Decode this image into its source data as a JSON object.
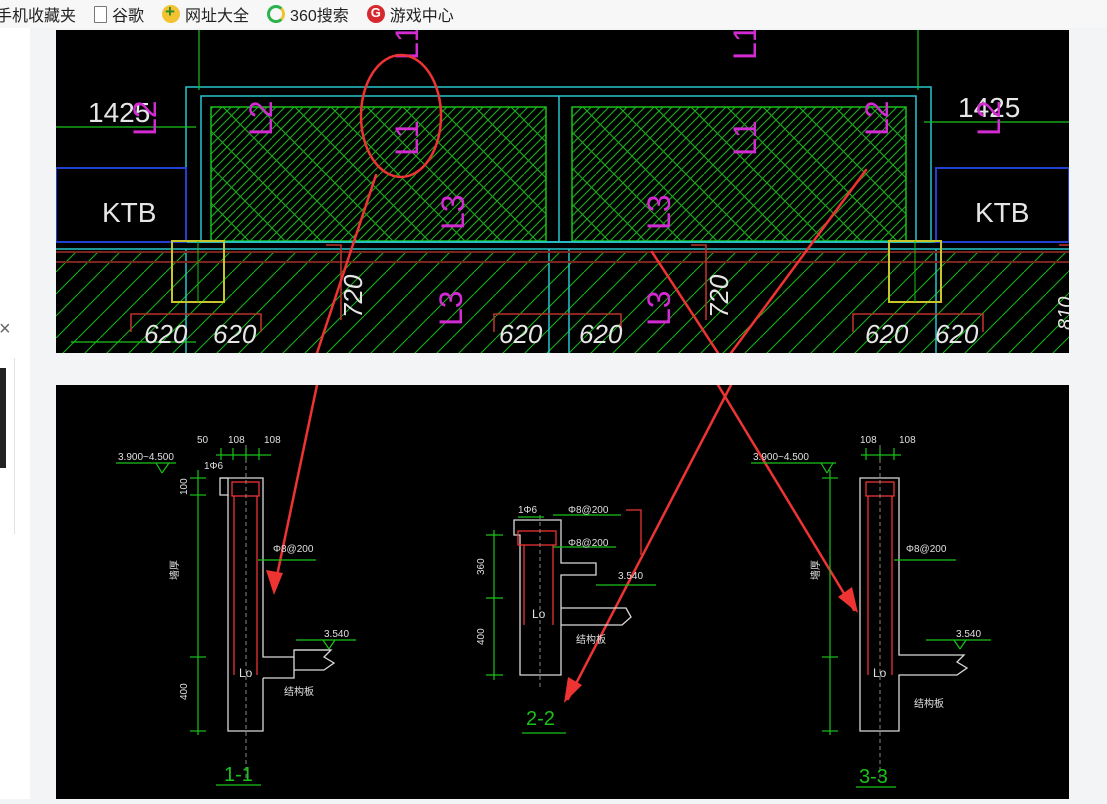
{
  "bookmarks": [
    {
      "label": "手机收藏夹",
      "icon": "bookmark-folder-icon"
    },
    {
      "label": "谷歌",
      "icon": "page-icon"
    },
    {
      "label": "网址大全",
      "icon": "web-nav-icon"
    },
    {
      "label": "360搜索",
      "icon": "360-search-icon"
    },
    {
      "label": "游戏中心",
      "icon": "game-center-icon"
    }
  ],
  "side_close_glyph": "×",
  "top_drawing": {
    "dim_left": "1425",
    "dim_right": "1425",
    "label_ktb": "KTB",
    "code_l1": "L1",
    "code_l2": "L2",
    "code_l3": "L3",
    "dim_620": "620",
    "dim_720": "720",
    "dim_810": "810"
  },
  "bottom_drawing": {
    "sections": [
      {
        "title": "1-1",
        "elev_top": "3.900~4.500",
        "dims_top": [
          "50",
          "108",
          "108"
        ],
        "dim_100": "100",
        "dim_400": "400",
        "rebar_a": "1Φ6",
        "rebar_b": "Φ8@200",
        "elev_slab": "3.540",
        "lo": "Lo",
        "note_side": "墙厚",
        "note_slab": "结构板"
      },
      {
        "title": "2-2",
        "rebar_a": "1Φ6",
        "rebar_b": "Φ8@200",
        "rebar_c": "Φ8@200",
        "dim_360": "360",
        "dim_400": "400",
        "elev_slab": "3.540",
        "lo": "Lo",
        "note_slab": "结构板"
      },
      {
        "title": "3-3",
        "elev_top": "3.900~4.500",
        "dims_top": [
          "108",
          "108"
        ],
        "rebar_b": "Φ8@200",
        "elev_slab": "3.540",
        "lo": "Lo",
        "note_side": "墙厚",
        "note_slab": "结构板"
      }
    ]
  },
  "colors": {
    "cad_bg": "#000000",
    "cyan": "#27c6cc",
    "green": "#19c219",
    "magenta": "#d12bd1",
    "red_dim": "#b8322a",
    "annotation_red": "#ee3333",
    "yellow": "#c6c62a"
  }
}
